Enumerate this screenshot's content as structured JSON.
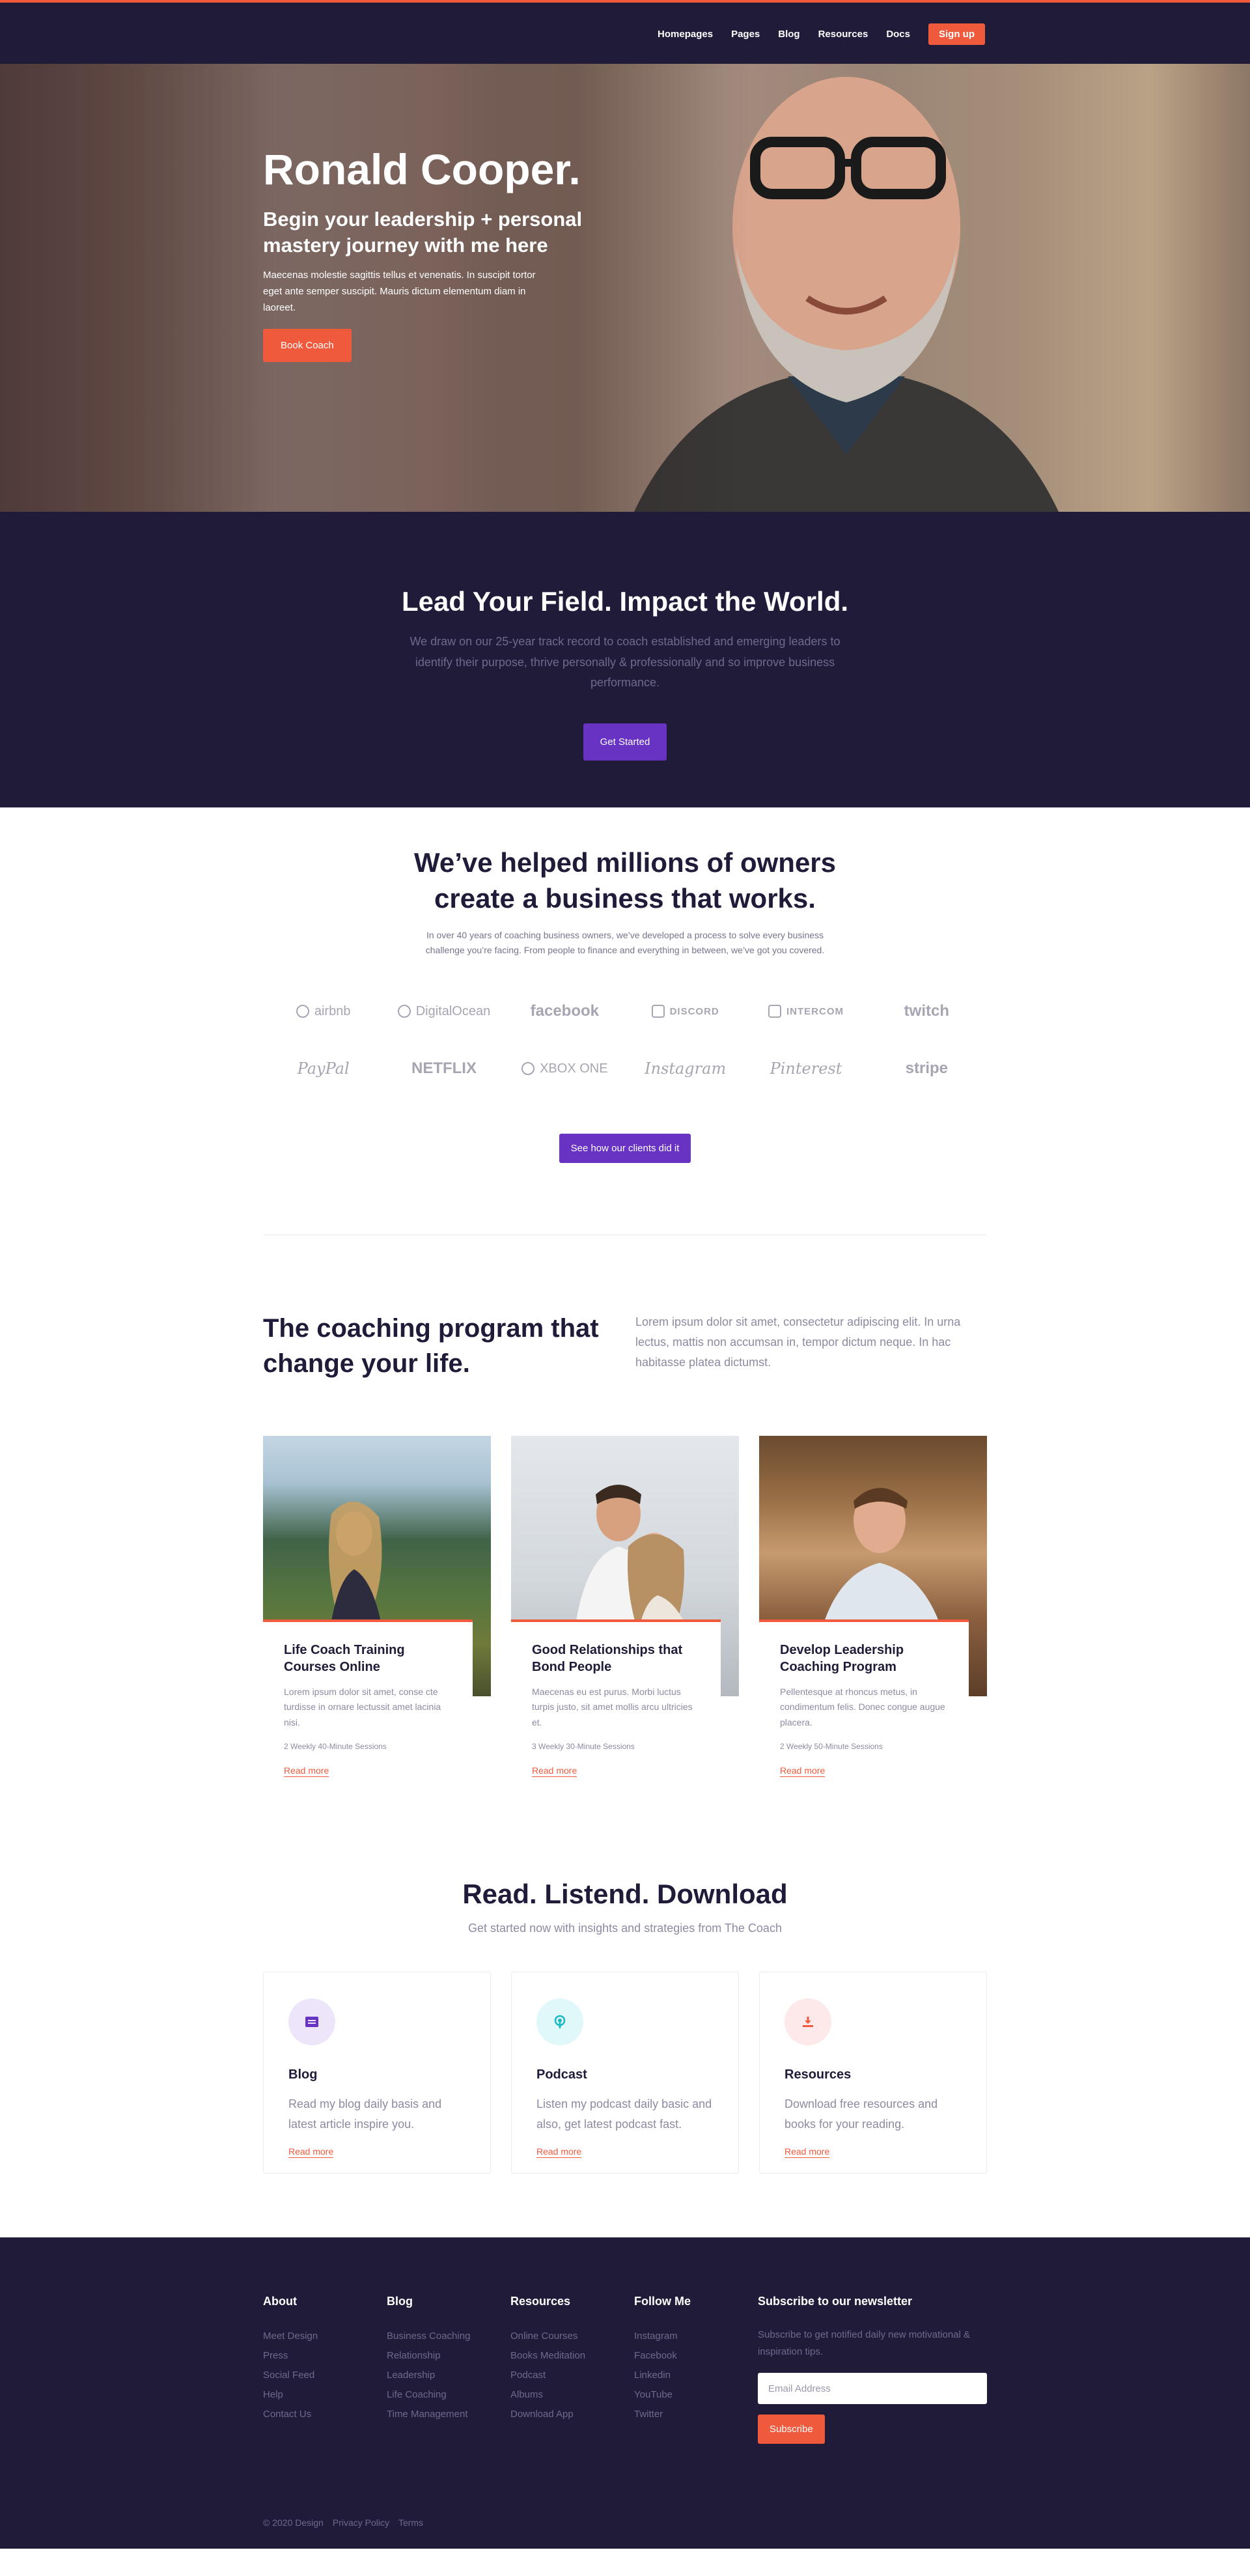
{
  "nav": {
    "links": [
      "Homepages",
      "Pages",
      "Blog",
      "Resources",
      "Docs"
    ],
    "signup": "Sign up"
  },
  "hero": {
    "title": "Ronald Cooper.",
    "subtitle": "Begin your leadership + personal mastery journey with me here",
    "description": "Maecenas molestie sagittis tellus et venenatis. In suscipit tortor eget ante semper suscipit. Mauris dictum elementum diam in laoreet.",
    "button": "Book Coach"
  },
  "lead": {
    "title": "Lead Your Field. Impact the World.",
    "text": "We draw on our 25-year track record to coach established and emerging leaders to identify their purpose, thrive personally & professionally and so improve business performance.",
    "button": "Get Started"
  },
  "helped": {
    "title": "We’ve helped millions of owners create a business that works.",
    "text": "In over 40 years of coaching business owners, we’ve developed a process to solve every business challenge you’re facing. From people to finance and everything in between, we’ve got you covered.",
    "logos": [
      "airbnb",
      "DigitalOcean",
      "facebook",
      "DISCORD",
      "INTERCOM",
      "twitch",
      "PayPal",
      "NETFLIX",
      "XBOX ONE",
      "Instagram",
      "Pinterest",
      "stripe"
    ],
    "button": "See how our clients did it"
  },
  "program": {
    "title": "The coaching program that change your life.",
    "text": "Lorem ipsum dolor sit amet, consectetur adipiscing elit. In urna lectus, mattis non accumsan in, tempor dictum neque. In hac habitasse platea dictumst."
  },
  "cards": [
    {
      "title": "Life Coach Training Courses Online",
      "text": "Lorem ipsum dolor sit amet, conse cte turdisse in ornare lectussit amet lacinia nisi.",
      "meta": "2 Weekly   40-Minute Sessions",
      "link": "Read more"
    },
    {
      "title": "Good Relationships that Bond People",
      "text": "Maecenas eu est purus. Morbi luctus turpis justo, sit amet mollis arcu ultricies et.",
      "meta": "3 Weekly   30-Minute Sessions",
      "link": "Read more"
    },
    {
      "title": "Develop Leadership Coaching Program",
      "text": "Pellentesque at rhoncus metus, in condimentum felis. Donec congue augue placera.",
      "meta": "2 Weekly   50-Minute Sessions",
      "link": "Read more"
    }
  ],
  "read": {
    "title": "Read. Listend. Download",
    "subtitle": "Get started now with insights and strategies from The Coach",
    "items": [
      {
        "title": "Blog",
        "text": "Read my blog daily basis and latest article inspire you.",
        "link": "Read more",
        "icon": "blog-icon",
        "color": "#6832c3",
        "bg": "#ede6fa"
      },
      {
        "title": "Podcast",
        "text": "Listen my podcast daily basic and also, get latest podcast fast.",
        "link": "Read more",
        "icon": "podcast-icon",
        "color": "#19b6c3",
        "bg": "#e0f8fa"
      },
      {
        "title": "Resources",
        "text": "Download free resources and books for your reading.",
        "link": "Read more",
        "icon": "download-icon",
        "color": "#f05a3c",
        "bg": "#fde8ea"
      }
    ]
  },
  "footer": {
    "columns": [
      {
        "title": "About",
        "links": [
          "Meet Design",
          "Press",
          "Social Feed",
          "Help",
          "Contact Us"
        ]
      },
      {
        "title": "Blog",
        "links": [
          "Business Coaching",
          "Relationship",
          "Leadership",
          "Life Coaching",
          "Time Management"
        ]
      },
      {
        "title": "Resources",
        "links": [
          "Online Courses",
          "Books Meditation",
          "Podcast",
          "Albums",
          "Download App"
        ]
      },
      {
        "title": "Follow Me",
        "links": [
          "Instagram",
          "Facebook",
          "Linkedin",
          "YouTube",
          "Twitter"
        ]
      }
    ],
    "newsletter": {
      "title": "Subscribe to our newsletter",
      "text": "Subscribe to get notified daily new motivational & inspiration tips.",
      "placeholder": "Email Address",
      "button": "Subscribe"
    },
    "copyright": "© 2020 Design",
    "privacy": "Privacy Policy",
    "terms": "Terms"
  },
  "colors": {
    "navy": "#211b3a",
    "accent": "#f05a3c",
    "purple": "#6832c3"
  }
}
